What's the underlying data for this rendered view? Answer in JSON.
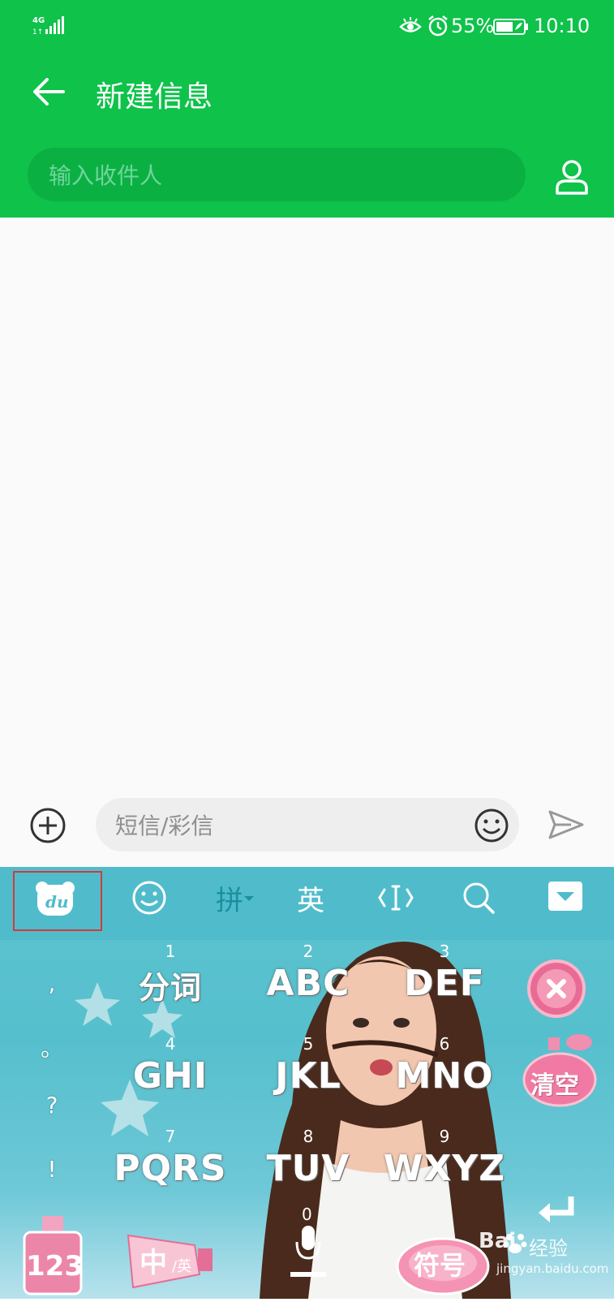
{
  "status_bar": {
    "network": "4G",
    "battery": "55%",
    "time": "10:10",
    "icons": [
      "signal-icon",
      "eye-icon",
      "alarm-icon",
      "battery-icon"
    ]
  },
  "header": {
    "title": "新建信息",
    "recipient_placeholder": "输入收件人"
  },
  "compose": {
    "placeholder": "短信/彩信"
  },
  "keyboard": {
    "toolbar": {
      "logo": "du",
      "pinyin": "拼",
      "english": "英"
    },
    "keys": [
      {
        "num": "1",
        "label": "分词"
      },
      {
        "num": "2",
        "label": "ABC"
      },
      {
        "num": "3",
        "label": "DEF"
      },
      {
        "num": "4",
        "label": "GHI"
      },
      {
        "num": "5",
        "label": "JKL"
      },
      {
        "num": "6",
        "label": "MNO"
      },
      {
        "num": "7",
        "label": "PQRS"
      },
      {
        "num": "8",
        "label": "TUV"
      },
      {
        "num": "9",
        "label": "WXYZ"
      }
    ],
    "punctuation": [
      ",",
      "。",
      "?",
      "!"
    ],
    "zero": "0",
    "bottom": {
      "numbers": "123",
      "lang_main": "中",
      "lang_sub": "/英",
      "symbols": "符号"
    },
    "side": {
      "clear": "清空"
    }
  },
  "watermark": {
    "brand": "Bai",
    "brand2": "经验",
    "url": "jingyan.baidu.com"
  },
  "colors": {
    "header_green": "#0ec24a",
    "keyboard_teal": "#56bfcd",
    "highlight_red": "#d23b3b"
  }
}
